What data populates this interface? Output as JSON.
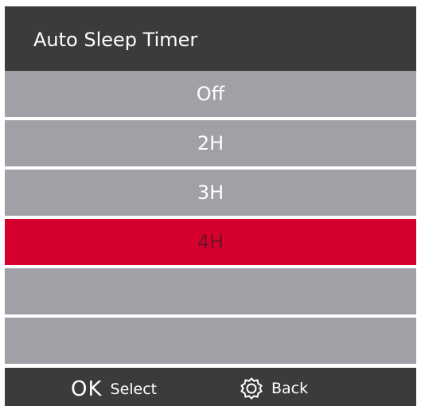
{
  "header": {
    "title": "Auto Sleep Timer"
  },
  "menu": {
    "items": [
      {
        "label": "Off",
        "selected": false
      },
      {
        "label": "2H",
        "selected": false
      },
      {
        "label": "3H",
        "selected": false
      },
      {
        "label": "4H",
        "selected": true
      },
      {
        "label": "",
        "selected": false
      },
      {
        "label": "",
        "selected": false
      }
    ],
    "selected_index": 3
  },
  "footer": {
    "ok_icon_text": "OK",
    "select_label": "Select",
    "back_icon": "gear-icon",
    "back_label": "Back"
  },
  "colors": {
    "header_bg": "#3b3b3b",
    "item_bg": "#a0a0a6",
    "selected_bg": "#d6002f",
    "selected_text": "#6d1225",
    "text": "#ffffff"
  }
}
